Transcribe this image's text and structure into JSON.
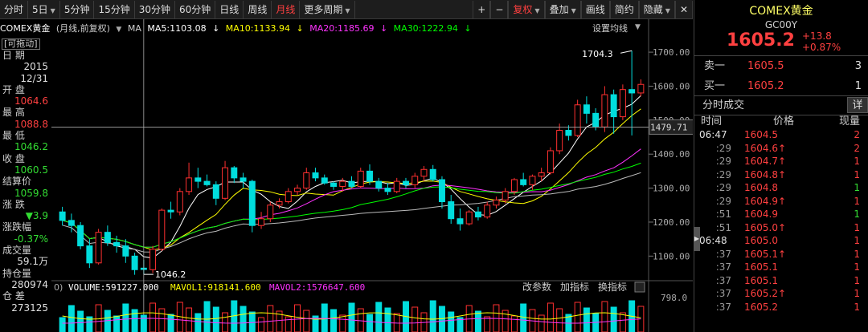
{
  "toolbar": {
    "items": [
      {
        "label": "分时",
        "caret": false,
        "active": false
      },
      {
        "label": "5日",
        "caret": true,
        "active": false
      },
      {
        "label": "5分钟",
        "caret": false,
        "active": false
      },
      {
        "label": "15分钟",
        "caret": false,
        "active": false
      },
      {
        "label": "30分钟",
        "caret": false,
        "active": false
      },
      {
        "label": "60分钟",
        "caret": false,
        "active": false
      },
      {
        "label": "日线",
        "caret": false,
        "active": false
      },
      {
        "label": "周线",
        "caret": false,
        "active": false
      },
      {
        "label": "月线",
        "caret": false,
        "active": true
      },
      {
        "label": "更多周期",
        "caret": true,
        "active": false
      }
    ],
    "right_items": [
      {
        "label": "+",
        "caret": false,
        "active": false
      },
      {
        "label": "−",
        "caret": false,
        "active": false
      },
      {
        "label": "复权",
        "caret": true,
        "active": true
      },
      {
        "label": "叠加",
        "caret": true,
        "active": false
      },
      {
        "label": "画线",
        "caret": false,
        "active": false
      },
      {
        "label": "简约",
        "caret": false,
        "active": false
      },
      {
        "label": "隐藏",
        "caret": true,
        "active": false
      }
    ]
  },
  "info": {
    "symbol": "COMEX黄金",
    "mode": "(月线,前复权)",
    "ma_label": "MA",
    "ma5": "MA5:1103.08",
    "ma10": "MA10:1133.94",
    "ma20": "MA20:1185.69",
    "ma30": "MA30:1222.94",
    "settings": "设置均线",
    "colors": {
      "ma5": "#ffffff",
      "ma10": "#ffff00",
      "ma20": "#ff33ff",
      "ma30": "#00ff00"
    }
  },
  "left_panel": {
    "drag": "[可拖动]",
    "rows": [
      {
        "label": "日 期",
        "value": "",
        "color": "#e0e0e0"
      },
      {
        "label": "",
        "value": "2015",
        "color": "#e0e0e0"
      },
      {
        "label": "",
        "value": "12/31",
        "color": "#e0e0e0"
      },
      {
        "label": "开 盘",
        "value": "",
        "color": "#e0e0e0"
      },
      {
        "label": "",
        "value": "1064.6",
        "color": "#ff4040"
      },
      {
        "label": "最 高",
        "value": "",
        "color": "#e0e0e0"
      },
      {
        "label": "",
        "value": "1088.8",
        "color": "#ff4040"
      },
      {
        "label": "最 低",
        "value": "",
        "color": "#e0e0e0"
      },
      {
        "label": "",
        "value": "1046.2",
        "color": "#33dd33"
      },
      {
        "label": "收 盘",
        "value": "",
        "color": "#e0e0e0"
      },
      {
        "label": "",
        "value": "1060.5",
        "color": "#33dd33"
      },
      {
        "label": "结算价",
        "value": "",
        "color": "#e0e0e0"
      },
      {
        "label": "",
        "value": "1059.8",
        "color": "#33dd33"
      },
      {
        "label": "涨 跌",
        "value": "",
        "color": "#e0e0e0"
      },
      {
        "label": "",
        "value": "▼3.9",
        "color": "#33dd33"
      },
      {
        "label": "涨跌幅",
        "value": "",
        "color": "#e0e0e0"
      },
      {
        "label": "",
        "value": "-0.37%",
        "color": "#33dd33"
      },
      {
        "label": "成交量",
        "value": "",
        "color": "#e0e0e0"
      },
      {
        "label": "",
        "value": "59.1万",
        "color": "#e0e0e0"
      },
      {
        "label": "持仓量",
        "value": "",
        "color": "#e0e0e0"
      },
      {
        "label": "",
        "value": "280974",
        "color": "#e0e0e0"
      },
      {
        "label": "仓 差",
        "value": "",
        "color": "#e0e0e0"
      },
      {
        "label": "",
        "value": "273125",
        "color": "#e0e0e0"
      }
    ]
  },
  "chart_data": {
    "type": "candlestick",
    "period": "月线",
    "price_axis": {
      "ticks": [
        "1700.00",
        "1600.00",
        "1500.00",
        "1400.00",
        "1300.00",
        "1200.00",
        "1100.00"
      ],
      "ylim": [
        1030,
        1745
      ]
    },
    "crosshair_price": "1479.71",
    "annotations": {
      "high": "1704.3",
      "low": "1046.2"
    },
    "candles": [
      [
        1230,
        1245,
        1190,
        1205
      ],
      [
        1205,
        1225,
        1170,
        1190
      ],
      [
        1190,
        1200,
        1120,
        1130
      ],
      [
        1130,
        1150,
        1065,
        1080
      ],
      [
        1080,
        1180,
        1075,
        1170
      ],
      [
        1170,
        1190,
        1130,
        1140
      ],
      [
        1140,
        1160,
        1110,
        1130
      ],
      [
        1130,
        1150,
        1080,
        1100
      ],
      [
        1100,
        1110,
        1045,
        1060
      ],
      [
        1064.6,
        1088.8,
        1046.2,
        1060.5
      ],
      [
        1060,
        1130,
        1050,
        1120
      ],
      [
        1120,
        1240,
        1115,
        1235
      ],
      [
        1235,
        1260,
        1210,
        1230
      ],
      [
        1230,
        1300,
        1220,
        1290
      ],
      [
        1290,
        1375,
        1280,
        1330
      ],
      [
        1330,
        1360,
        1300,
        1320
      ],
      [
        1320,
        1340,
        1305,
        1310
      ],
      [
        1310,
        1320,
        1250,
        1270
      ],
      [
        1270,
        1380,
        1265,
        1360
      ],
      [
        1360,
        1365,
        1315,
        1330
      ],
      [
        1330,
        1345,
        1300,
        1320
      ],
      [
        1320,
        1325,
        1170,
        1190
      ],
      [
        1190,
        1230,
        1180,
        1210
      ],
      [
        1210,
        1260,
        1200,
        1250
      ],
      [
        1250,
        1270,
        1240,
        1260
      ],
      [
        1260,
        1300,
        1255,
        1290
      ],
      [
        1290,
        1310,
        1280,
        1300
      ],
      [
        1300,
        1360,
        1295,
        1345
      ],
      [
        1345,
        1360,
        1320,
        1330
      ],
      [
        1330,
        1340,
        1310,
        1315
      ],
      [
        1315,
        1320,
        1295,
        1305
      ],
      [
        1305,
        1330,
        1290,
        1320
      ],
      [
        1320,
        1335,
        1300,
        1305
      ],
      [
        1305,
        1360,
        1300,
        1350
      ],
      [
        1350,
        1370,
        1310,
        1320
      ],
      [
        1320,
        1330,
        1290,
        1300
      ],
      [
        1300,
        1315,
        1280,
        1290
      ],
      [
        1290,
        1330,
        1285,
        1320
      ],
      [
        1320,
        1330,
        1300,
        1310
      ],
      [
        1310,
        1345,
        1300,
        1335
      ],
      [
        1335,
        1365,
        1320,
        1355
      ],
      [
        1355,
        1368,
        1320,
        1325
      ],
      [
        1325,
        1335,
        1240,
        1260
      ],
      [
        1260,
        1280,
        1195,
        1210
      ],
      [
        1210,
        1240,
        1175,
        1195
      ],
      [
        1195,
        1235,
        1190,
        1230
      ],
      [
        1230,
        1245,
        1205,
        1215
      ],
      [
        1215,
        1260,
        1210,
        1250
      ],
      [
        1250,
        1275,
        1240,
        1265
      ],
      [
        1265,
        1300,
        1255,
        1290
      ],
      [
        1290,
        1330,
        1280,
        1325
      ],
      [
        1325,
        1345,
        1305,
        1310
      ],
      [
        1310,
        1340,
        1295,
        1335
      ],
      [
        1335,
        1360,
        1320,
        1345
      ],
      [
        1345,
        1420,
        1340,
        1410
      ],
      [
        1410,
        1490,
        1400,
        1470
      ],
      [
        1470,
        1485,
        1440,
        1455
      ],
      [
        1455,
        1560,
        1450,
        1545
      ],
      [
        1545,
        1570,
        1490,
        1520
      ],
      [
        1520,
        1535,
        1470,
        1480
      ],
      [
        1480,
        1600,
        1465,
        1575
      ],
      [
        1575,
        1590,
        1460,
        1510
      ],
      [
        1510,
        1605,
        1500,
        1590
      ],
      [
        1590,
        1704.3,
        1455,
        1580
      ],
      [
        1580,
        1620,
        1570,
        1605.2
      ]
    ],
    "ma_series": [
      {
        "name": "MA5",
        "color": "#ffffff",
        "values": []
      },
      {
        "name": "MA10",
        "color": "#ffff00",
        "values": []
      },
      {
        "name": "MA20",
        "color": "#ff33ff",
        "values": []
      },
      {
        "name": "MA30",
        "color": "#00ff00",
        "values": []
      }
    ]
  },
  "volume": {
    "label": "VOLUME:591227.000",
    "mavol1": "MAVOL1:918141.600",
    "mavol2": "MAVOL2:1576647.600",
    "prefix": "0)",
    "buttons": [
      "改参数",
      "加指标",
      "换指标"
    ],
    "axis_tick": "798.0",
    "colors": {
      "volume": "#ffffff",
      "mavol1": "#ffff00",
      "mavol2": "#ff33ff"
    }
  },
  "sidebar": {
    "title": "COMEX黄金",
    "code": "GC00Y",
    "price": "1605.2",
    "change": "+13.8",
    "change_pct": "+0.87%",
    "orderbook": [
      {
        "label": "卖一",
        "price": "1605.5",
        "vol": "3"
      },
      {
        "label": "买一",
        "price": "1605.2",
        "vol": "1"
      }
    ],
    "ticks_title": "分时成交",
    "detail_btn": "详",
    "col_time": "时间",
    "col_price": "价格",
    "col_vol": "现量",
    "ticks": [
      {
        "time": "06:47",
        "full": true,
        "price": "1604.5",
        "arrow": "",
        "vol": "2",
        "vcolor": "red"
      },
      {
        "time": ":29",
        "full": false,
        "price": "1604.6",
        "arrow": "↑",
        "vol": "2",
        "vcolor": "red"
      },
      {
        "time": ":29",
        "full": false,
        "price": "1604.7",
        "arrow": "↑",
        "vol": "1",
        "vcolor": "red"
      },
      {
        "time": ":29",
        "full": false,
        "price": "1604.8",
        "arrow": "↑",
        "vol": "1",
        "vcolor": "red"
      },
      {
        "time": ":29",
        "full": false,
        "price": "1604.8",
        "arrow": "",
        "vol": "1",
        "vcolor": "green"
      },
      {
        "time": ":29",
        "full": false,
        "price": "1604.9",
        "arrow": "↑",
        "vol": "1",
        "vcolor": "red"
      },
      {
        "time": ":51",
        "full": false,
        "price": "1604.9",
        "arrow": "",
        "vol": "1",
        "vcolor": "green"
      },
      {
        "time": ":51",
        "full": false,
        "price": "1605.0",
        "arrow": "↑",
        "vol": "1",
        "vcolor": "red"
      },
      {
        "time": "06:48",
        "full": true,
        "price": "1605.0",
        "arrow": "",
        "vol": "1",
        "vcolor": "red"
      },
      {
        "time": ":37",
        "full": false,
        "price": "1605.1",
        "arrow": "↑",
        "vol": "1",
        "vcolor": "red"
      },
      {
        "time": ":37",
        "full": false,
        "price": "1605.1",
        "arrow": "",
        "vol": "1",
        "vcolor": "red"
      },
      {
        "time": ":37",
        "full": false,
        "price": "1605.1",
        "arrow": "",
        "vol": "1",
        "vcolor": "red"
      },
      {
        "time": ":37",
        "full": false,
        "price": "1605.2",
        "arrow": "↑",
        "vol": "1",
        "vcolor": "red"
      },
      {
        "time": ":37",
        "full": false,
        "price": "1605.2",
        "arrow": "",
        "vol": "1",
        "vcolor": "red"
      }
    ]
  }
}
